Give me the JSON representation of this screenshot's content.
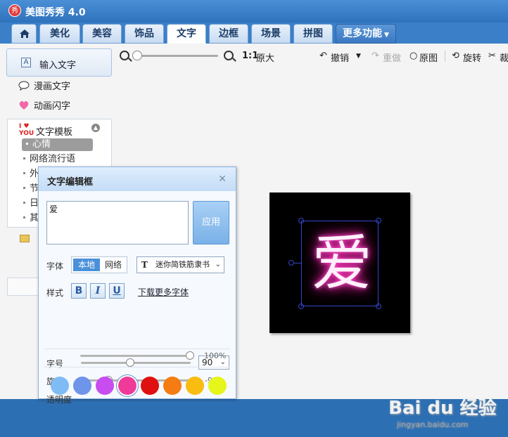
{
  "app": {
    "title": "美图秀秀 4.0",
    "logo_char": "秀"
  },
  "tabs": [
    {
      "label": ""
    },
    {
      "label": "美化"
    },
    {
      "label": "美容"
    },
    {
      "label": "饰品"
    },
    {
      "label": "文字"
    },
    {
      "label": "边框"
    },
    {
      "label": "场景"
    },
    {
      "label": "拼图"
    },
    {
      "label": "更多功能"
    }
  ],
  "active_tab": "文字",
  "sidebar": {
    "primary_button": "输入文字",
    "items": [
      {
        "label": "漫画文字",
        "icon": "speech-bubble-icon"
      },
      {
        "label": "动画闪字",
        "icon": "heart-icon"
      }
    ],
    "template_group": {
      "label": "文字模板",
      "icon_text": "I ♥ YOU",
      "subitems": [
        "心情",
        "网络流行语",
        "外",
        "节",
        "日",
        "其"
      ],
      "selected": "心情"
    }
  },
  "toolbar": {
    "zoom_ratio_label": "1:1",
    "original_size": "原大",
    "undo": "撤销",
    "redo": "重做",
    "original_image": "原图",
    "rotate": "旋转",
    "crop": "裁"
  },
  "canvas": {
    "text": "爱",
    "glow_color": "#ff2fb8"
  },
  "dialog": {
    "title": "文字编辑框",
    "text_value": "爱",
    "apply": "应用",
    "font_label": "字体",
    "font_local": "本地",
    "font_network": "网络",
    "font_selected": "迷你简铁筋隶书",
    "style_label": "样式",
    "bold": "B",
    "italic": "I",
    "underline": "U",
    "download_fonts": "下载更多字体",
    "size_label": "字号",
    "size_value": "90",
    "size_level": 0.45,
    "rotate_label": "旋转",
    "rotate_value": "-90°",
    "rotate_level": 0.25,
    "opacity_label": "透明度",
    "opacity_value": "100%",
    "opacity_level": 1.0,
    "colors": [
      "#7fbcf5",
      "#6f95ea",
      "#c84cf0",
      "#f03a9a",
      "#e01010",
      "#f57c12",
      "#f9bc10",
      "#e6f51a"
    ],
    "selected_color": "#f03a9a"
  },
  "watermark": {
    "brand": "Bai du 经验",
    "url": "jingyan.baidu.com"
  }
}
